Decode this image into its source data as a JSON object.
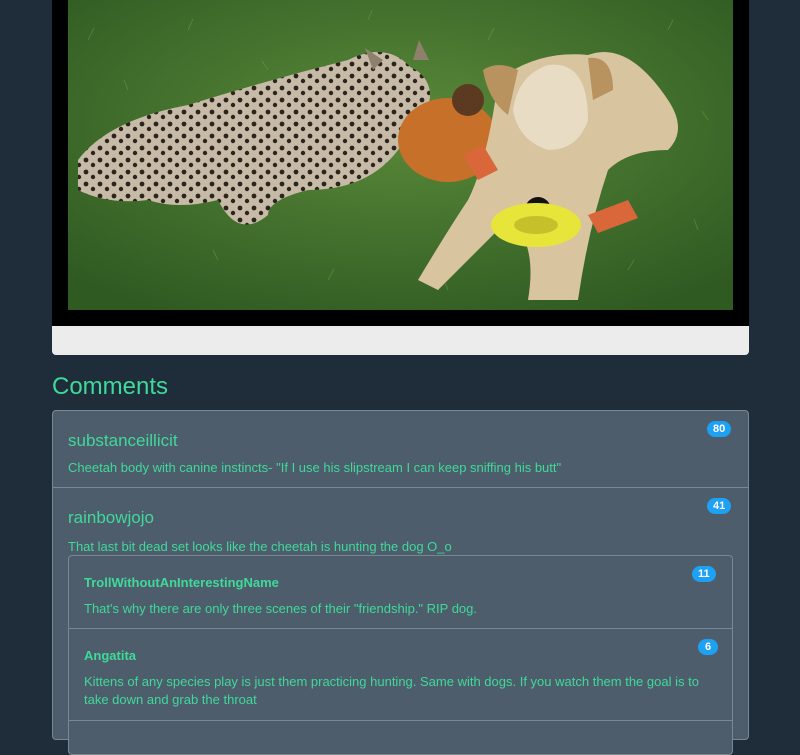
{
  "section_title": "Comments",
  "comments": [
    {
      "author": "substanceillicit",
      "score": "80",
      "text": "Cheetah body with canine instincts- \"If I use his slipstream I can keep sniffing his butt\""
    },
    {
      "author": "rainbowjojo",
      "score": "41",
      "text": "That last bit dead set looks like the cheetah is hunting the dog O_o",
      "replies": [
        {
          "author": "TrollWithoutAnInterestingName",
          "score": "11",
          "text": "That's why there are only three scenes of their \"friendship.\" RIP dog."
        },
        {
          "author": "Angatita",
          "score": "6",
          "text": "Kittens of any species play is just them practicing hunting. Same with dogs. If you watch them the goal is to take down and grab the throat"
        }
      ]
    }
  ]
}
